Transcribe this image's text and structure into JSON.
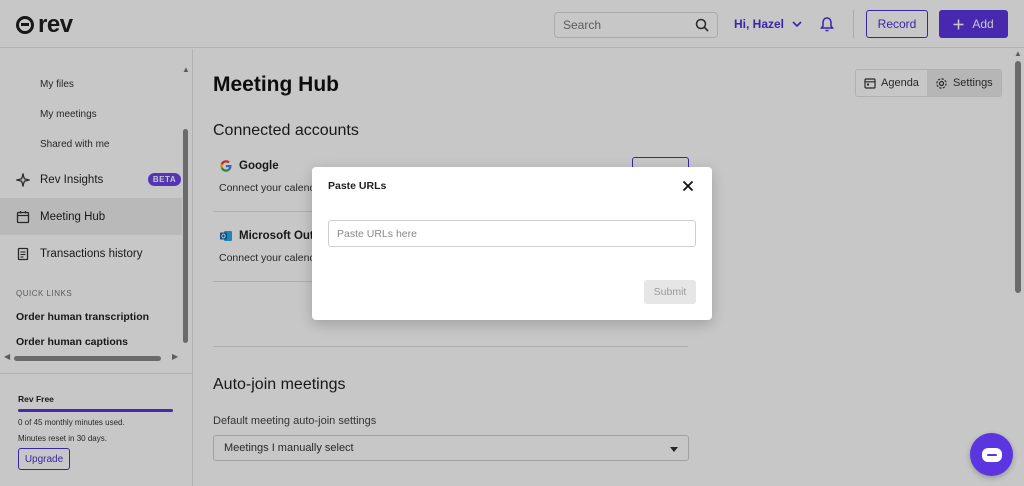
{
  "app": {
    "logo_text": "rev"
  },
  "header": {
    "search_placeholder": "Search",
    "greeting": "Hi, Hazel",
    "record_label": "Record",
    "add_label": "Add"
  },
  "sidebar": {
    "sub_items": [
      {
        "label": "My files"
      },
      {
        "label": "My meetings"
      },
      {
        "label": "Shared with me"
      }
    ],
    "items": [
      {
        "label": "Rev Insights",
        "icon": "sparkle-icon",
        "badge": "BETA"
      },
      {
        "label": "Meeting Hub",
        "icon": "calendar-icon"
      },
      {
        "label": "Transactions history",
        "icon": "receipt-icon"
      }
    ],
    "quick_links_title": "QUICK LINKS",
    "quick_links": [
      {
        "label": "Order human transcription"
      },
      {
        "label": "Order human captions"
      }
    ],
    "plan": {
      "name": "Rev Free",
      "usage": "0 of 45 monthly minutes used.",
      "reset": "Minutes reset in 30 days.",
      "upgrade_label": "Upgrade",
      "usage_fraction": 0.0
    }
  },
  "main": {
    "title": "Meeting Hub",
    "view_toggle": [
      {
        "label": "Agenda",
        "icon": "calendar-icon",
        "selected": false
      },
      {
        "label": "Settings",
        "icon": "gear-icon",
        "selected": true
      }
    ],
    "connected_accounts": {
      "title": "Connected accounts",
      "accounts": [
        {
          "name": "Google",
          "desc": "Connect your calenc",
          "icon": "google-icon"
        },
        {
          "name": "Microsoft Outlo",
          "desc": "Connect your calenc",
          "icon": "outlook-icon"
        }
      ]
    },
    "auto_join": {
      "title": "Auto-join meetings",
      "field_label": "Default meeting auto-join settings",
      "selected_value": "Meetings I manually select"
    }
  },
  "modal": {
    "title": "Paste URLs",
    "input_placeholder": "Paste URLs here",
    "submit_label": "Submit"
  },
  "colors": {
    "accent": "#5b35e0",
    "brand_text": "#4b2fd6",
    "beta_badge": "#6b45e8",
    "overlay": "rgba(0,0,0,0.22)"
  }
}
